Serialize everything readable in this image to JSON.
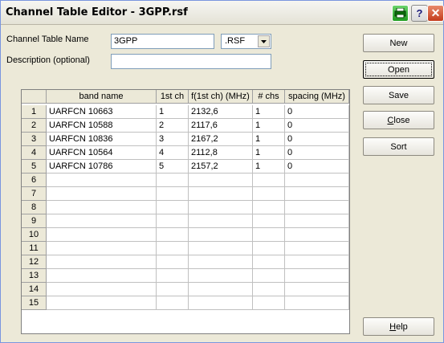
{
  "window": {
    "title": "Channel Table Editor - 3GPP.rsf"
  },
  "titlebar_icons": {
    "print": "printer-icon",
    "help": "help-icon",
    "close": "close-icon",
    "help_glyph": "?",
    "close_glyph": "✕"
  },
  "form": {
    "channel_table_name_label": "Channel Table Name",
    "channel_table_name_value": "3GPP",
    "file_type_value": ".RSF",
    "description_label": "Description (optional)",
    "description_value": ""
  },
  "buttons": {
    "new": "New",
    "open": "Open",
    "save": "Save",
    "close_prefix": "",
    "close_ul": "C",
    "close_rest": "lose",
    "sort": "Sort",
    "help_ul": "H",
    "help_rest": "elp"
  },
  "table": {
    "columns": [
      "band name",
      "1st ch",
      "f(1st ch) (MHz)",
      "# chs",
      "spacing (MHz)"
    ],
    "row_numbers": [
      "1",
      "2",
      "3",
      "4",
      "5",
      "6",
      "7",
      "8",
      "9",
      "10",
      "11",
      "12",
      "13",
      "14",
      "15"
    ],
    "rows": [
      [
        "UARFCN  10663",
        "1",
        "2132,6",
        "1",
        "0"
      ],
      [
        "UARFCN  10588",
        "2",
        "2117,6",
        "1",
        "0"
      ],
      [
        "UARFCN  10836",
        "3",
        "2167,2",
        "1",
        "0"
      ],
      [
        "UARFCN  10564",
        "4",
        "2112,8",
        "1",
        "0"
      ],
      [
        "UARFCN  10786",
        "5",
        "2157,2",
        "1",
        "0"
      ],
      [
        "",
        "",
        "",
        "",
        ""
      ],
      [
        "",
        "",
        "",
        "",
        ""
      ],
      [
        "",
        "",
        "",
        "",
        ""
      ],
      [
        "",
        "",
        "",
        "",
        ""
      ],
      [
        "",
        "",
        "",
        "",
        ""
      ],
      [
        "",
        "",
        "",
        "",
        ""
      ],
      [
        "",
        "",
        "",
        "",
        ""
      ],
      [
        "",
        "",
        "",
        "",
        ""
      ],
      [
        "",
        "",
        "",
        "",
        ""
      ],
      [
        "",
        "",
        "",
        "",
        ""
      ]
    ]
  }
}
